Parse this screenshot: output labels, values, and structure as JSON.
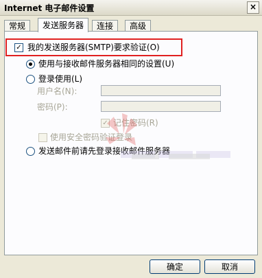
{
  "window": {
    "title": "Internet 电子邮件设置",
    "close_glyph": "×"
  },
  "tabs": [
    {
      "label": "常规",
      "active": false
    },
    {
      "label": "发送服务器",
      "active": true
    },
    {
      "label": "连接",
      "active": false
    },
    {
      "label": "高级",
      "active": false
    }
  ],
  "smtp_auth": {
    "label": "我的发送服务器(SMTP)要求验证(O)",
    "checked": true
  },
  "options": {
    "same_as_incoming": {
      "label": "使用与接收邮件服务器相同的设置(U)",
      "selected": true
    },
    "login_with": {
      "label": "登录使用(L)",
      "selected": false
    },
    "login_before_send": {
      "label": "发送邮件前请先登录接收邮件服务器",
      "selected": false
    }
  },
  "fields": {
    "username_label": "用户名(N):",
    "username_value": "",
    "password_label": "密码(P):",
    "password_value": ""
  },
  "checkboxes": {
    "remember_password": {
      "label": "记住密码(R)",
      "checked": true,
      "enabled": false
    },
    "spa": {
      "label": "使用安全密码验证登录",
      "checked": false,
      "enabled": false
    }
  },
  "buttons": {
    "ok": "确定",
    "cancel": "取消"
  },
  "colors": {
    "highlight": "#e02020",
    "dialog_bg": "#ece9d8",
    "panel_bg": "#fcfcfe"
  }
}
